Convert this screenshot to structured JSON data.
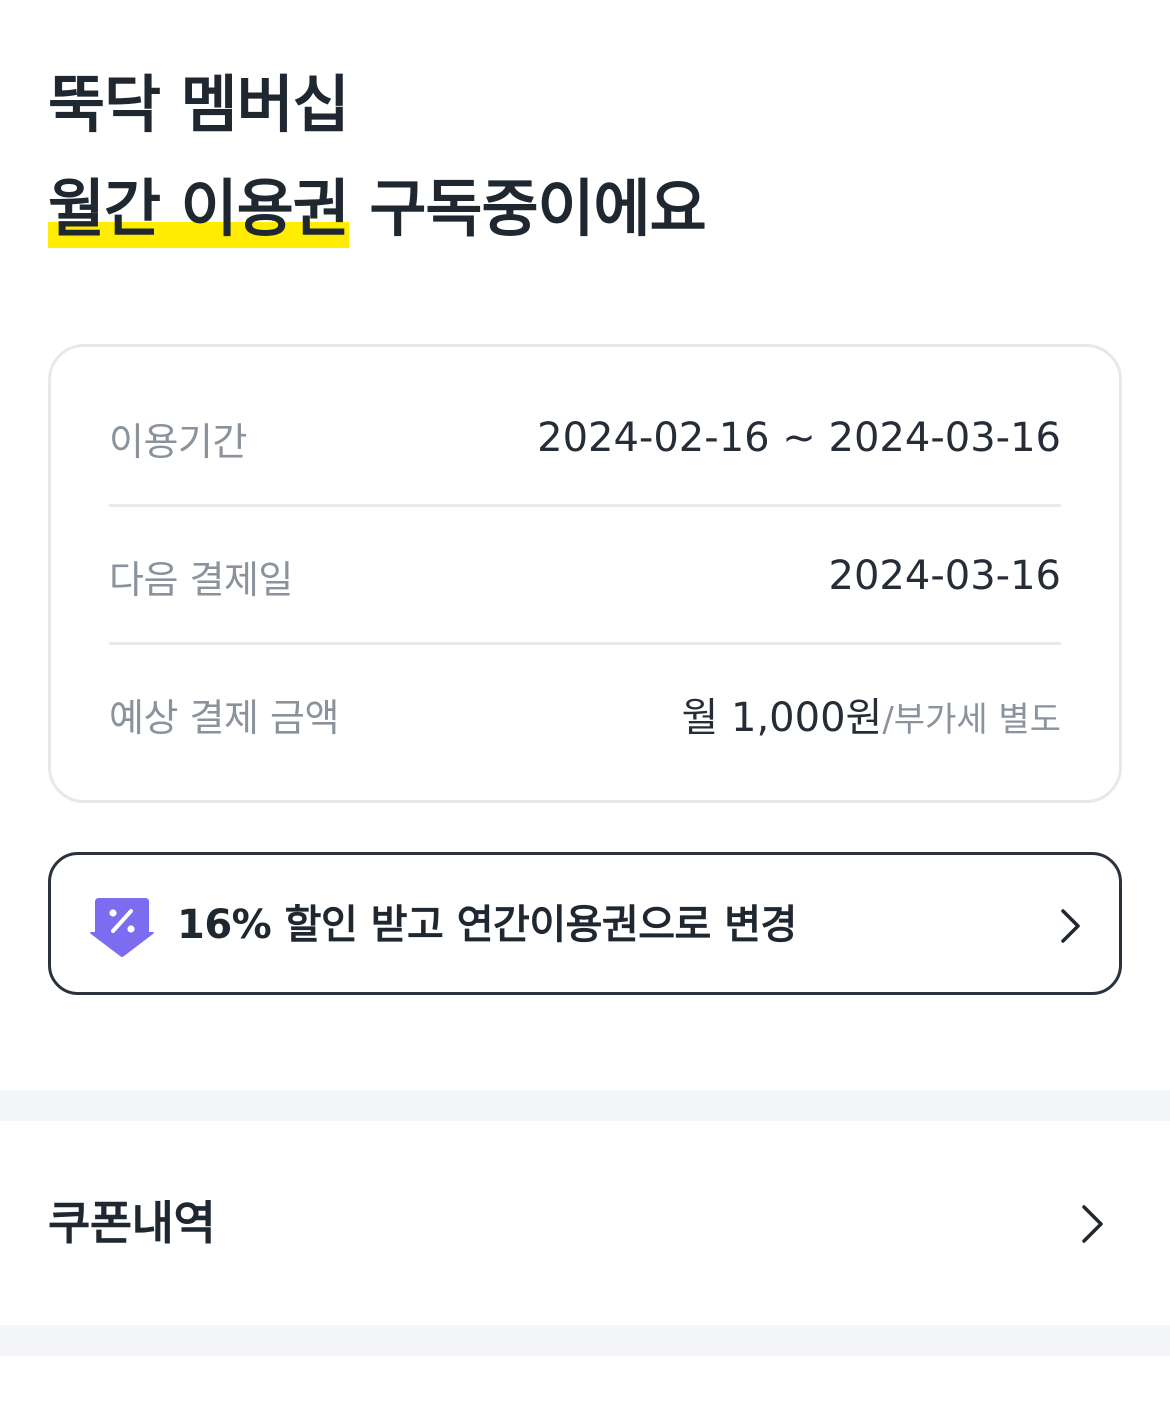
{
  "header": {
    "title_line1": "뚝닥 멤버십",
    "plan_highlight": "월간 이용권",
    "title_line2_suffix": " 구독중이에요"
  },
  "subscription": {
    "rows": [
      {
        "label": "이용기간",
        "value": "2024-02-16 ~ 2024-03-16"
      },
      {
        "label": "다음 결제일",
        "value": "2024-03-16"
      },
      {
        "label": "예상 결제 금액",
        "value": "월 1,000원",
        "value_sub": "/부가세 별도"
      }
    ]
  },
  "upgrade_banner": {
    "text": "16% 할인 받고 연간이용권으로 변경",
    "icon": "discount-coupon-icon",
    "chevron_icon": "chevron-right-icon"
  },
  "menu": {
    "coupon_history_label": "쿠폰내역",
    "chevron_icon": "chevron-right-icon"
  },
  "colors": {
    "highlight": "#ffec00",
    "coupon_icon": "#7b6cf0",
    "text_primary": "#1f2730",
    "text_secondary": "#8a929c",
    "section_gap": "#f3f5f8"
  }
}
